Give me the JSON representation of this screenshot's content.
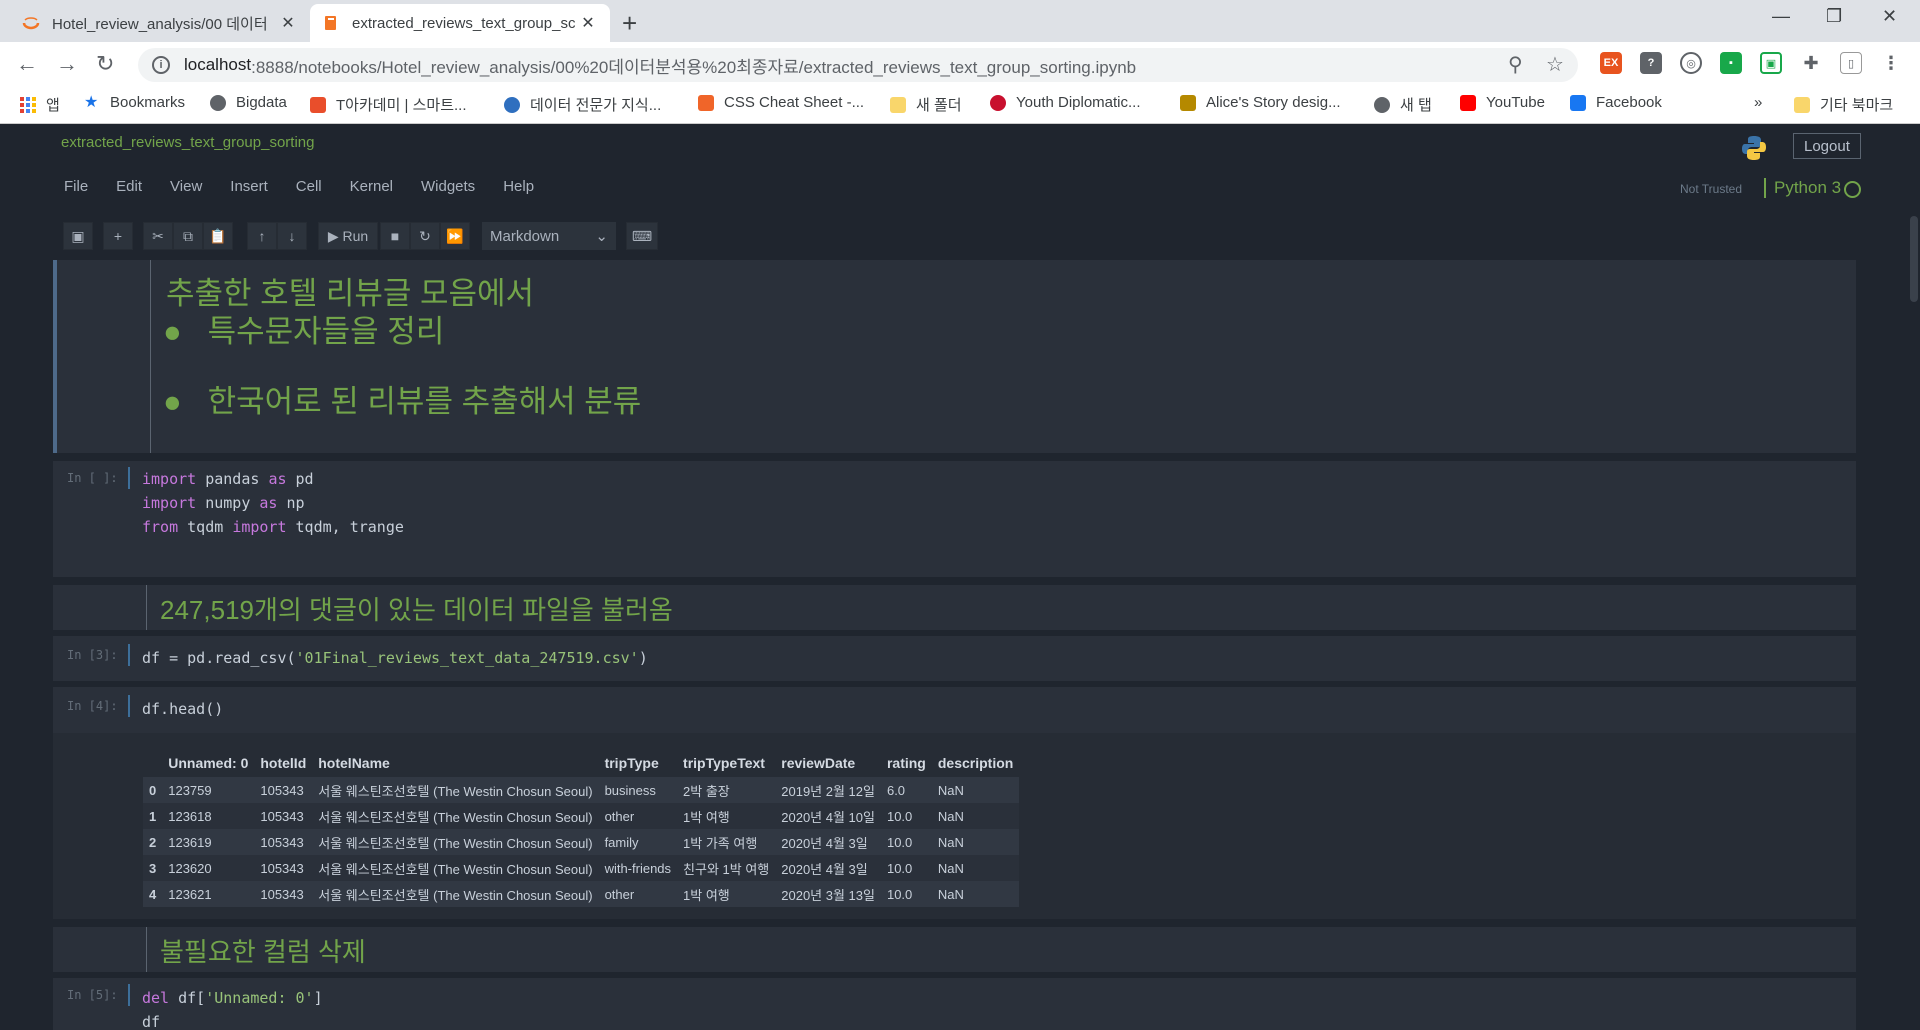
{
  "browser": {
    "tabs": [
      {
        "title": "Hotel_review_analysis/00 데이터",
        "active": false
      },
      {
        "title": "extracted_reviews_text_group_sc",
        "active": true
      }
    ],
    "new_tab": "+",
    "url_host": "localhost",
    "url_path": ":8888/notebooks/Hotel_review_analysis/00%20데이터분석용%20최종자료/extracted_reviews_text_group_sorting.ipynb",
    "window_controls": [
      "—",
      "❐",
      "✕"
    ]
  },
  "bookmarks": [
    {
      "label": "앱",
      "color": "#e34133"
    },
    {
      "label": "Bookmarks",
      "color": "#1a73e8"
    },
    {
      "label": "Bigdata",
      "color": "#5f6368"
    },
    {
      "label": "T아카데미 | 스마트...",
      "color": "#e94e2b"
    },
    {
      "label": "데이터 전문가 지식...",
      "color": "#2f6fbf"
    },
    {
      "label": "CSS Cheat Sheet -...",
      "color": "#f06529"
    },
    {
      "label": "새 폴더",
      "color": "#f9d66b"
    },
    {
      "label": "Youth Diplomatic...",
      "color": "#c8102e"
    },
    {
      "label": "Alice's Story desig...",
      "color": "#b58900"
    },
    {
      "label": "새 탭",
      "color": "#5f6368"
    },
    {
      "label": "YouTube",
      "color": "#ff0000"
    },
    {
      "label": "Facebook",
      "color": "#1877f2"
    },
    {
      "label": "»",
      "color": ""
    },
    {
      "label": "기타 북마크",
      "color": "#f9d66b"
    }
  ],
  "jupyter": {
    "notebook_title": "extracted_reviews_text_group_sorting",
    "logout_label": "Logout",
    "menu": [
      "File",
      "Edit",
      "View",
      "Insert",
      "Cell",
      "Kernel",
      "Widgets",
      "Help"
    ],
    "not_trusted": "Not Trusted",
    "kernel": "Python 3",
    "run_label": "Run",
    "cell_type": "Markdown"
  },
  "cells": {
    "md1": {
      "heading": "추출한 호텔 리뷰글 모음에서",
      "bullets": [
        "특수문자들을 정리",
        "한국어로 된 리뷰를 추출해서 분류"
      ]
    },
    "code1": {
      "prompt": "In [ ]:",
      "lines": [
        [
          "import",
          " pandas ",
          "as",
          " pd"
        ],
        [
          "import",
          " numpy ",
          "as",
          " np"
        ],
        [
          "from",
          " tqdm ",
          "import",
          " tqdm, trange"
        ]
      ]
    },
    "md2": {
      "heading": "247,519개의 댓글이 있는 데이터 파일을 불러옴"
    },
    "code2": {
      "prompt": "In [3]:",
      "pre": "df = pd.read_csv(",
      "str": "'01Final_reviews_text_data_247519.csv'",
      "post": ")"
    },
    "code3": {
      "prompt": "In [4]:",
      "code": "df.head()"
    },
    "table": {
      "columns": [
        "",
        "Unnamed: 0",
        "hotelId",
        "hotelName",
        "tripType",
        "tripTypeText",
        "reviewDate",
        "rating",
        "description"
      ],
      "rows": [
        [
          "0",
          "123759",
          "105343",
          "서울 웨스틴조선호텔 (The Westin Chosun Seoul)",
          "business",
          "2박 출장",
          "2019년 2월 12일",
          "6.0",
          "NaN"
        ],
        [
          "1",
          "123618",
          "105343",
          "서울 웨스틴조선호텔 (The Westin Chosun Seoul)",
          "other",
          "1박 여행",
          "2020년 4월 10일",
          "10.0",
          "NaN"
        ],
        [
          "2",
          "123619",
          "105343",
          "서울 웨스틴조선호텔 (The Westin Chosun Seoul)",
          "family",
          "1박 가족 여행",
          "2020년 4월 3일",
          "10.0",
          "NaN"
        ],
        [
          "3",
          "123620",
          "105343",
          "서울 웨스틴조선호텔 (The Westin Chosun Seoul)",
          "with-friends",
          "친구와 1박 여행",
          "2020년 4월 3일",
          "10.0",
          "NaN"
        ],
        [
          "4",
          "123621",
          "105343",
          "서울 웨스틴조선호텔 (The Westin Chosun Seoul)",
          "other",
          "1박 여행",
          "2020년 3월 13일",
          "10.0",
          "NaN"
        ]
      ]
    },
    "md3": {
      "heading": "불필요한 컬럼 삭제"
    },
    "code4": {
      "prompt": "In [5]:",
      "kw": "del",
      "pre": " df[",
      "str": "'Unnamed: 0'",
      "post": "]",
      "line2": "df"
    }
  }
}
